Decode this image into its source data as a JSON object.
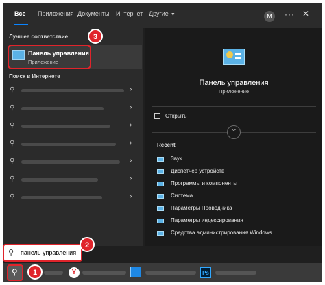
{
  "tabs": [
    {
      "label": "Все",
      "active": true
    },
    {
      "label": "Приложения"
    },
    {
      "label": "Документы"
    },
    {
      "label": "Интернет"
    },
    {
      "label": "Другие"
    }
  ],
  "header": {
    "avatar_letter": "M",
    "more": "···",
    "close": "✕"
  },
  "best_match": {
    "heading": "Лучшее соответствие",
    "title": "Панель управления",
    "subtitle": "Приложение",
    "icon": "control-panel-icon"
  },
  "web": {
    "heading": "Поиск в Интернете",
    "item_count_note": "blurred suggestions"
  },
  "detail": {
    "title": "Панель управления",
    "subtitle": "Приложение",
    "open_label": "Открыть",
    "recent_heading": "Recent",
    "recent_items": [
      "Звук",
      "Диспетчер устройств",
      "Программы и компоненты",
      "Система",
      "Параметры Проводника",
      "Параметры индексирования",
      "Средства администрирования Windows"
    ]
  },
  "search": {
    "value": "панель управления"
  },
  "badges": [
    "1",
    "2",
    "3"
  ],
  "taskbar": {
    "yandex": "Y",
    "photoshop": "Ps"
  },
  "colors": {
    "accent_red": "#e0242b",
    "window_bg": "#1f1f1f",
    "panel_bg": "#2b2b2b",
    "icon_blue": "#5bb2e6"
  }
}
